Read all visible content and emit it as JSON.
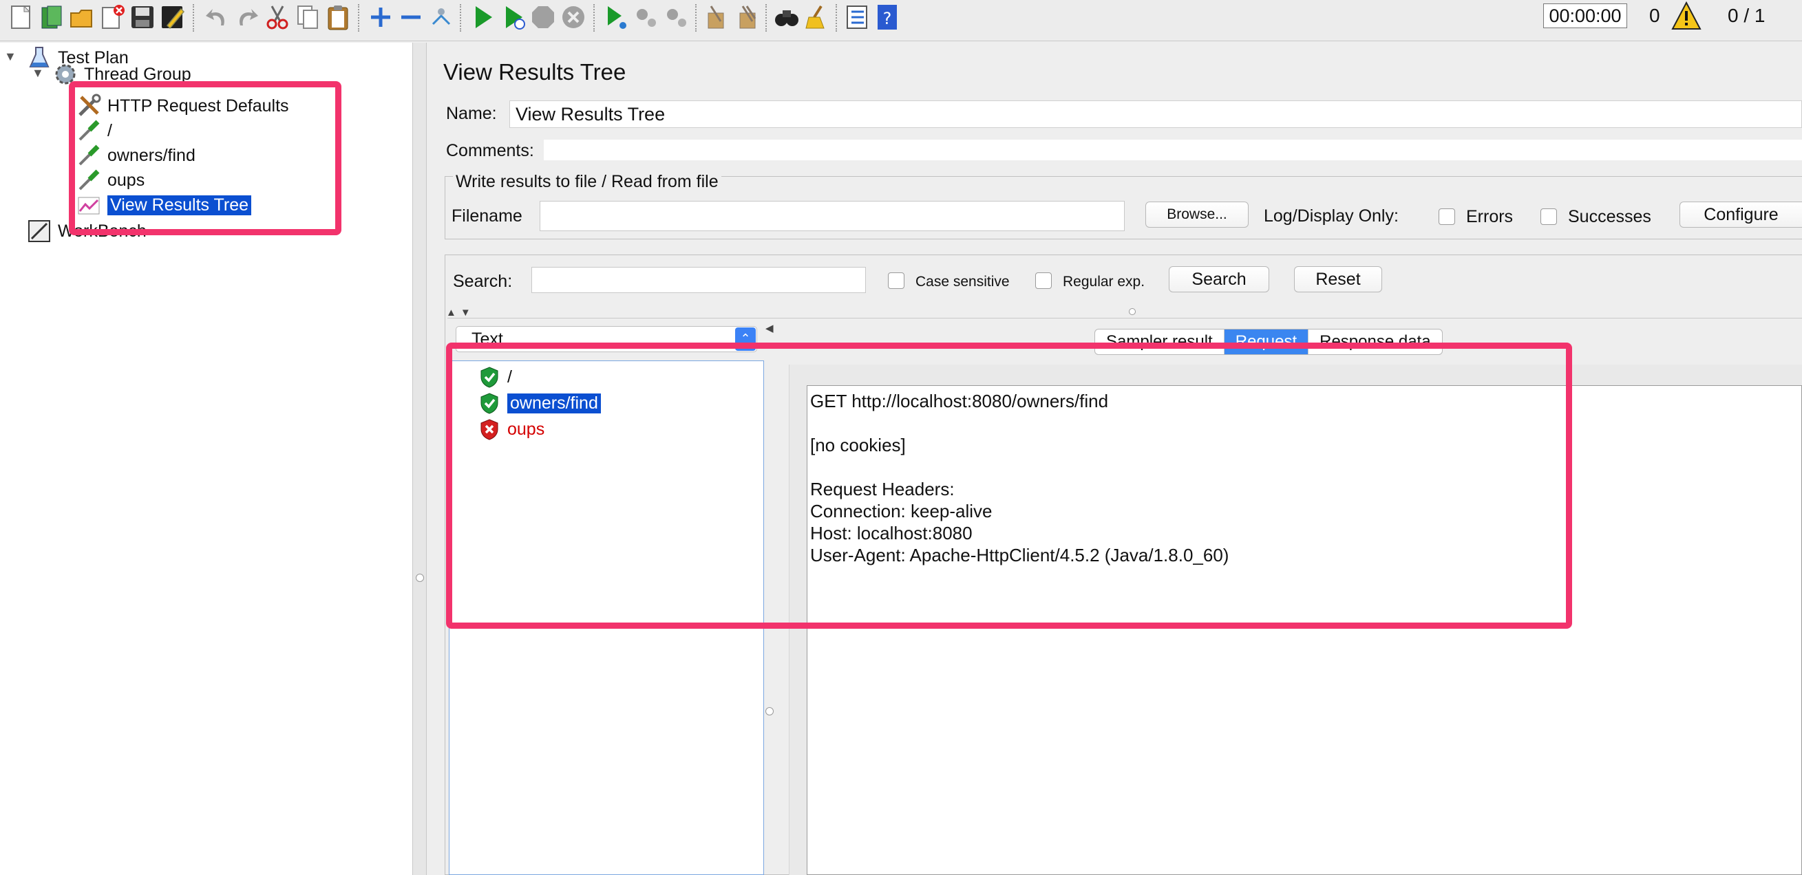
{
  "toolbar": {
    "timer": "00:00:00",
    "active_threads": "0",
    "thread_ratio": "0 / 1"
  },
  "tree": {
    "test_plan": "Test Plan",
    "thread_group": "Thread Group",
    "children": [
      "HTTP Request Defaults",
      "/",
      "owners/find",
      "oups",
      "View Results Tree"
    ],
    "workbench": "WorkBench"
  },
  "panel": {
    "title": "View Results Tree",
    "name_label": "Name:",
    "name_value": "View Results Tree",
    "comments_label": "Comments:",
    "file_group_title": "Write results to file / Read from file",
    "filename_label": "Filename",
    "browse_button": "Browse...",
    "log_display_label": "Log/Display Only:",
    "errors_label": "Errors",
    "successes_label": "Successes",
    "configure_button": "Configure"
  },
  "search": {
    "label": "Search:",
    "case_sensitive": "Case sensitive",
    "regular_exp": "Regular exp.",
    "search_button": "Search",
    "reset_button": "Reset"
  },
  "results": {
    "renderer": "Text",
    "items": [
      {
        "label": "/",
        "status": "success"
      },
      {
        "label": "owners/find",
        "status": "success"
      },
      {
        "label": "oups",
        "status": "error"
      }
    ],
    "tabs": [
      "Sampler result",
      "Request",
      "Response data"
    ],
    "active_tab": "Request",
    "request_text": "GET http://localhost:8080/owners/find\n\n[no cookies]\n\nRequest Headers:\nConnection: keep-alive\nHost: localhost:8080\nUser-Agent: Apache-HttpClient/4.5.2 (Java/1.8.0_60)"
  },
  "colors": {
    "selection": "#0b4fd1",
    "annotation": "#f2336c",
    "error_text": "#d40000",
    "tab_active": "#3a86f0"
  }
}
